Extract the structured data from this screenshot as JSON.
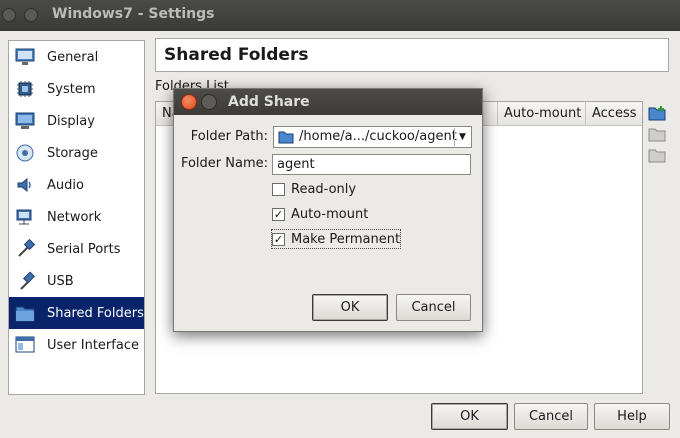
{
  "window": {
    "title": "Windows7 - Settings"
  },
  "sidebar": {
    "items": [
      {
        "label": "General",
        "icon": "monitor-icon"
      },
      {
        "label": "System",
        "icon": "chip-icon"
      },
      {
        "label": "Display",
        "icon": "display-icon"
      },
      {
        "label": "Storage",
        "icon": "storage-icon"
      },
      {
        "label": "Audio",
        "icon": "audio-icon"
      },
      {
        "label": "Network",
        "icon": "network-icon"
      },
      {
        "label": "Serial Ports",
        "icon": "serial-ports-icon"
      },
      {
        "label": "USB",
        "icon": "usb-icon"
      },
      {
        "label": "Shared Folders",
        "icon": "folder-icon",
        "selected": true
      },
      {
        "label": "User Interface",
        "icon": "user-interface-icon"
      }
    ]
  },
  "main": {
    "title": "Shared Folders",
    "folders_label": "Folders List",
    "columns": [
      "Na",
      "Auto-mount",
      "Access"
    ]
  },
  "dialog": {
    "title": "Add Share",
    "folder_path_label": "Folder Path:",
    "folder_path_value": "/home/a.../cuckoo/agent",
    "folder_name_label": "Folder Name:",
    "folder_name_value": "agent",
    "readonly_label": "Read-only",
    "readonly_checked": false,
    "automount_label": "Auto-mount",
    "automount_checked": true,
    "permanent_label": "Make Permanent",
    "permanent_checked": true,
    "ok_label": "OK",
    "cancel_label": "Cancel"
  },
  "buttons": {
    "ok": "OK",
    "cancel": "Cancel",
    "help": "Help"
  },
  "colors": {
    "selection": "#09246a",
    "titlebar": "#3c3b38",
    "close": "#df4b1a"
  }
}
